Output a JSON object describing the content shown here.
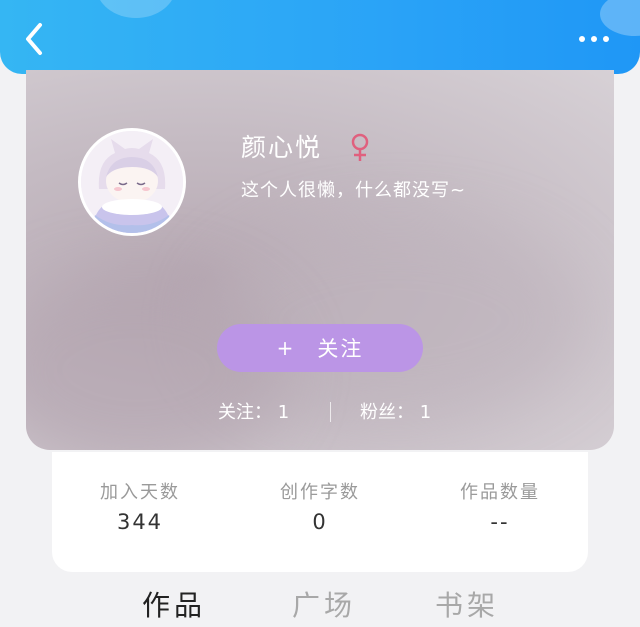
{
  "header": {
    "back_icon": "chevron-left-icon",
    "more_icon": "more-dots-icon",
    "colors": {
      "start": "#35b6f3",
      "end": "#1f97f6"
    }
  },
  "profile": {
    "username": "颜心悦",
    "gender_icon": "female-symbol-icon",
    "gender_color": "#e0607e",
    "bio": "这个人很懒，什么都没写~",
    "follow_button": {
      "plus": "+",
      "label": "关注",
      "color": "#bb95e6"
    },
    "following": "关注： 1",
    "fans": "粉丝： 1"
  },
  "info": [
    {
      "label": "加入天数",
      "value": "344"
    },
    {
      "label": "创作字数",
      "value": "0"
    },
    {
      "label": "作品数量",
      "value": "--"
    }
  ],
  "tabs": [
    {
      "label": "作品",
      "active": true
    },
    {
      "label": "广场",
      "active": false
    },
    {
      "label": "书架",
      "active": false
    }
  ]
}
